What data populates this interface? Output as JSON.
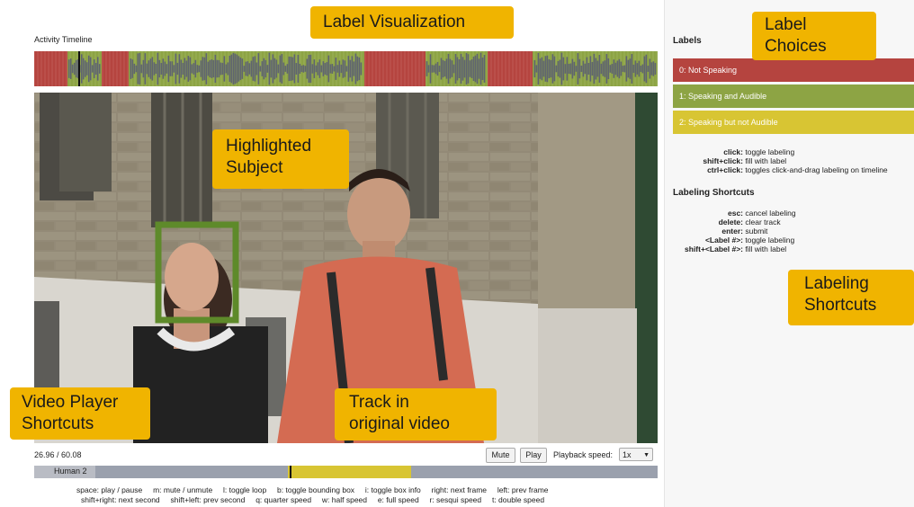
{
  "timeline": {
    "title": "Activity Timeline",
    "segments": [
      {
        "start": 0.0,
        "end": 0.053,
        "label": 0
      },
      {
        "start": 0.053,
        "end": 0.108,
        "label": 1
      },
      {
        "start": 0.108,
        "end": 0.152,
        "label": 0
      },
      {
        "start": 0.152,
        "end": 0.529,
        "label": 1
      },
      {
        "start": 0.529,
        "end": 0.627,
        "label": 0
      },
      {
        "start": 0.627,
        "end": 0.727,
        "label": 1
      },
      {
        "start": 0.727,
        "end": 0.8,
        "label": 0
      },
      {
        "start": 0.8,
        "end": 1.0,
        "label": 1
      }
    ],
    "playhead_fraction": 0.07
  },
  "player": {
    "time_display": "26.96 / 60.08",
    "mute_label": "Mute",
    "play_label": "Play",
    "speed_label": "Playback speed:",
    "speed_value": "1x",
    "track_name": "Human 2",
    "track_highlight": {
      "start": 0.407,
      "end": 0.605
    },
    "track_playhead": 0.41
  },
  "shortcuts": {
    "line1": [
      "space: play / pause",
      "m: mute / unmute",
      "l: toggle loop",
      "b: toggle bounding box",
      "i: toggle box info",
      "right: next frame",
      "left: prev frame"
    ],
    "line2": [
      "shift+right: next second",
      "shift+left: prev second",
      "q: quarter speed",
      "w: half speed",
      "e: full speed",
      "r: sesqui speed",
      "t: double speed"
    ]
  },
  "labels_panel": {
    "title": "Labels",
    "choices": [
      {
        "text": "0: Not Speaking",
        "color": "#b5443f"
      },
      {
        "text": "1: Speaking and Audible",
        "color": "#8da444"
      },
      {
        "text": "2: Speaking but not Audible",
        "color": "#d8c533"
      }
    ],
    "click_help": [
      {
        "key": "click:",
        "desc": "toggle labeling"
      },
      {
        "key": "shift+click:",
        "desc": "fill with label"
      },
      {
        "key": "ctrl+click:",
        "desc": "toggles click-and-drag labeling on timeline"
      }
    ],
    "shortcuts_title": "Labeling Shortcuts",
    "shortcut_help": [
      {
        "key": "esc:",
        "desc": "cancel labeling"
      },
      {
        "key": "delete:",
        "desc": "clear track"
      },
      {
        "key": "enter:",
        "desc": "submit"
      },
      {
        "key": "<Label #>:",
        "desc": "toggle labeling"
      },
      {
        "key": "shift+<Label #>:",
        "desc": "fill with label"
      }
    ]
  },
  "callouts": {
    "label_visualization": "Label Visualization",
    "label_choices_1": "Label",
    "label_choices_2": "Choices",
    "highlighted_1": "Highlighted",
    "highlighted_2": "Subject",
    "labeling_shortcuts_1": "Labeling",
    "labeling_shortcuts_2": "Shortcuts",
    "video_player_1": "Video Player",
    "video_player_2": "Shortcuts",
    "track_1": "Track in",
    "track_2": "original video"
  },
  "colors": {
    "not_speaking": "#b5443f",
    "speaking_audible": "#8da444",
    "speaking_not_audible": "#d8c533",
    "callout": "#f0b400",
    "face_box": "#5e8a2a"
  }
}
